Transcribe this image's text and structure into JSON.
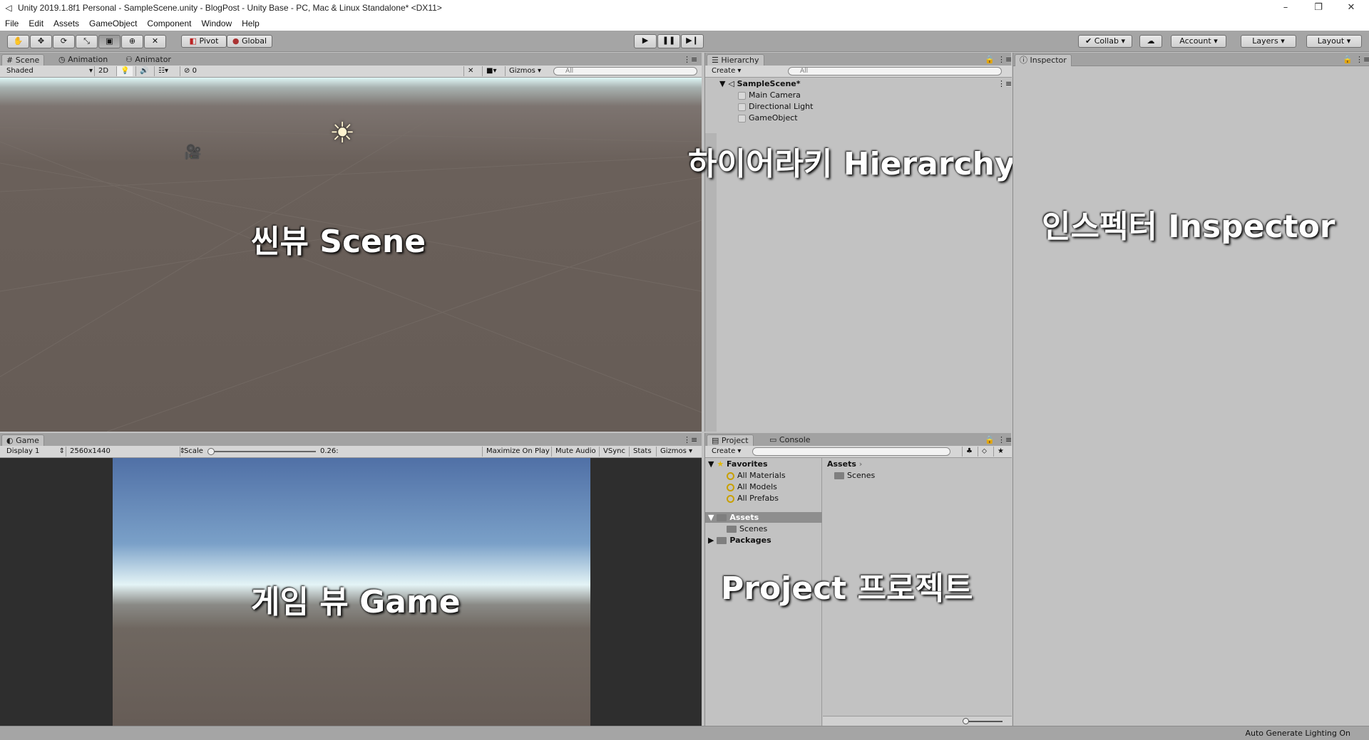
{
  "window": {
    "title": "Unity 2019.1.8f1 Personal - SampleScene.unity - BlogPost - Unity Base - PC, Mac & Linux Standalone* <DX11>",
    "minimize": "–",
    "restore": "❐",
    "close": "✕"
  },
  "menu": [
    "File",
    "Edit",
    "Assets",
    "GameObject",
    "Component",
    "Window",
    "Help"
  ],
  "toolbar": {
    "pivot": "Pivot",
    "global": "Global",
    "collab": "Collab",
    "account": "Account",
    "layers": "Layers",
    "layout": "Layout"
  },
  "scene_panel": {
    "tabs": [
      "Scene",
      "Animation",
      "Animator"
    ],
    "shading": "Shaded",
    "mode_2d": "2D",
    "hidden_count": "0",
    "gizmos": "Gizmos",
    "search_placeholder": "All",
    "overlay_label": "씬뷰 Scene"
  },
  "hierarchy_panel": {
    "tab": "Hierarchy",
    "create": "Create",
    "search_placeholder": "All",
    "scene_name": "SampleScene*",
    "items": [
      "Main Camera",
      "Directional Light",
      "GameObject"
    ],
    "overlay_label": "하이어라키 Hierarchy"
  },
  "inspector_panel": {
    "tab": "Inspector",
    "overlay_label": "인스펙터 Inspector"
  },
  "game_panel": {
    "tab": "Game",
    "display": "Display 1",
    "resolution": "2560x1440",
    "scale_label": "Scale",
    "scale_value": "0.26:",
    "scale_fraction": 0.02,
    "options": [
      "Maximize On Play",
      "Mute Audio",
      "VSync",
      "Stats",
      "Gizmos"
    ],
    "overlay_label": "게임 뷰 Game"
  },
  "project_panel": {
    "tabs": [
      "Project",
      "Console"
    ],
    "create": "Create",
    "favorites": {
      "label": "Favorites",
      "items": [
        "All Materials",
        "All Models",
        "All Prefabs"
      ]
    },
    "assets_label": "Assets",
    "assets_children": [
      "Scenes"
    ],
    "packages_label": "Packages",
    "breadcrumb": "Assets",
    "content_items": [
      "Scenes"
    ],
    "overlay_label": "Project 프로젝트"
  },
  "statusbar": {
    "text": "Auto Generate Lighting On"
  }
}
